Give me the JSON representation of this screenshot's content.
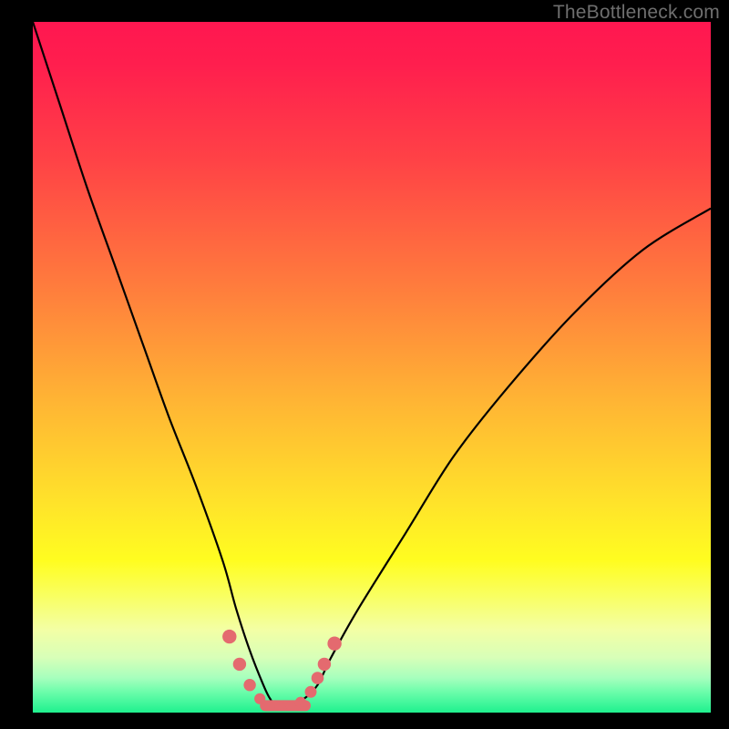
{
  "watermark": "TheBottleneck.com",
  "colors": {
    "background": "#000000",
    "curve_stroke": "#000000",
    "marker_fill": "#e46a6f",
    "marker_stroke": "#c94f56"
  },
  "chart_data": {
    "type": "line",
    "title": "",
    "xlabel": "",
    "ylabel": "",
    "xlim": [
      0,
      100
    ],
    "ylim": [
      0,
      100
    ],
    "grid": false,
    "legend": false,
    "note": "No axis ticks or numeric labels are rendered; values below are visual estimates on a 0–100 scale inferred from pixel positions (x right-positive, y increasing upward / green=low, red=high).",
    "series": [
      {
        "name": "bottleneck-curve",
        "x": [
          0,
          4,
          8,
          12,
          16,
          20,
          24,
          28,
          30,
          32,
          34,
          35,
          36,
          38,
          40,
          42,
          44,
          48,
          55,
          62,
          70,
          80,
          90,
          100
        ],
        "y": [
          100,
          88,
          76,
          65,
          54,
          43,
          33,
          22,
          15,
          9,
          4,
          2,
          1,
          1,
          2,
          4,
          8,
          15,
          26,
          37,
          47,
          58,
          67,
          73
        ]
      }
    ],
    "markers": {
      "name": "highlighted-points",
      "x": [
        29,
        30.5,
        32,
        33.5,
        35,
        36.5,
        38,
        39.5,
        41,
        42,
        43,
        44.5
      ],
      "y": [
        11,
        7,
        4,
        2,
        1,
        1,
        1,
        1.5,
        3,
        5,
        7,
        10
      ]
    }
  }
}
